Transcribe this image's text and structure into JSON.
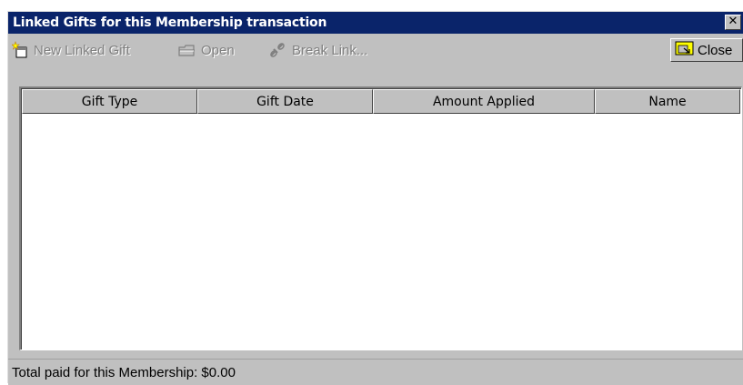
{
  "window": {
    "title": "Linked Gifts for this Membership transaction",
    "close_glyph": "✕"
  },
  "toolbar": {
    "new_linked_gift": {
      "label": "New Linked Gift",
      "icon": "new-gift-sparkle-icon"
    },
    "open": {
      "label": "Open",
      "icon": "open-folder-icon"
    },
    "break_link": {
      "label": "Break Link...",
      "icon": "broken-link-icon"
    },
    "close": {
      "label": "Close",
      "icon": "close-folder-icon"
    }
  },
  "grid": {
    "columns": [
      "Gift Type",
      "Gift Date",
      "Amount Applied",
      "Name"
    ],
    "rows": []
  },
  "status": {
    "text": "Total paid for this Membership: $0.00"
  },
  "colors": {
    "titlebar": "#0a246a",
    "face": "#c0c0c0",
    "disabled_text": "#808080"
  }
}
